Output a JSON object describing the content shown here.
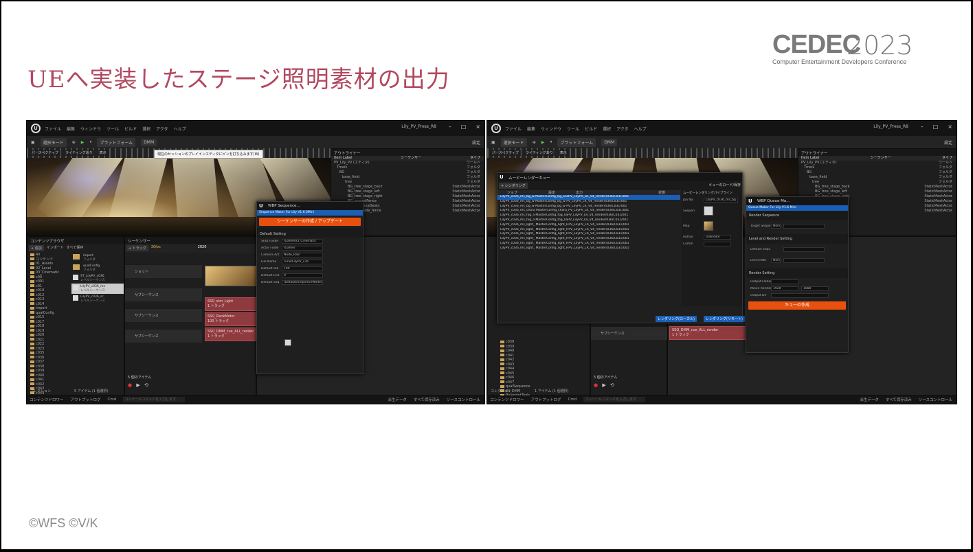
{
  "slide": {
    "title": "UEへ実装したステージ照明素材の出力",
    "logo_word": "CEDEC",
    "logo_year": "2023",
    "logo_sub": "Computer Entertainment Developers Conference",
    "copyright": "©WFS ©V/K",
    "title_color": "#b2485f"
  },
  "left": {
    "menu": [
      "ファイル",
      "編集",
      "ウィンドウ",
      "ツール",
      "ビルド",
      "選択",
      "アクタ",
      "ヘルプ"
    ],
    "window_title": "Lily_PV_Press_R8",
    "tab": "名称未設定",
    "toolbar": [
      "選択モード",
      "プラットフォーム",
      "DMM"
    ],
    "toolbar_right": "設定",
    "viewport_tools": [
      "パースペクティブ",
      "ライティングあり",
      "表示"
    ],
    "tooltip": "現在のセッションのプレイインエディタにピンを打ち込みます(W)",
    "outliner_title": "アウトライナー",
    "outliner_cols": [
      "Item Label",
      "シーケンサー",
      "タイプ"
    ],
    "outliner_rows": [
      [
        "PV_Lily_PV (エディタ)",
        "ワールド"
      ],
      [
        "Tmeik",
        "フォルダ"
      ],
      [
        "BG",
        "フォルダ"
      ],
      [
        "base_field",
        "フォルダ"
      ],
      [
        "tree",
        "フォルダ"
      ],
      [
        "BG_tree_stage_back",
        "StaticMeshActor"
      ],
      [
        "BG_tree_stage_left",
        "StaticMeshActor"
      ],
      [
        "BG_tree_stage_right",
        "StaticMeshActor"
      ],
      [
        "BG_aroundFence",
        "StaticMeshActor"
      ],
      [
        "BG_audienceSeats",
        "StaticMeshActor"
      ],
      [
        "BG_backSide_fence",
        "StaticMeshActor"
      ]
    ],
    "content_browser": "コンテンツブラウザ",
    "add_btn": "+ 追加",
    "import_btn": "インポート",
    "save_all": "すべて保存",
    "tree": [
      "All",
      "コンテンツ",
      "01_Assets",
      "02_Level",
      "03_Cinematic",
      "c00",
      "c001",
      "c01",
      "c010",
      "c012",
      "c013",
      "c014",
      "import",
      "qualConfig",
      "c015",
      "c017",
      "c018",
      "c019",
      "c020",
      "c021",
      "c022",
      "c023",
      "c035",
      "c036",
      "c037",
      "c038",
      "c039",
      "c040",
      "c041",
      "c042",
      "c043",
      "c044"
    ],
    "assets": [
      {
        "name": "import",
        "type": "フォルダ"
      },
      {
        "name": "qualConfig",
        "type": "フォルダ"
      },
      {
        "name": "ST_LilyPV_c036",
        "type": "レベルシーケンス"
      },
      {
        "name": "LilyPV_c036_me",
        "type": "レベルシーケンス"
      },
      {
        "name": "LilyPV_c036_sc",
        "type": "レベルシーケンス"
      }
    ],
    "asset_count": "5 アイテム (1 個選択)",
    "collection": "コレクション",
    "sequencer_title": "シーケンサー",
    "track_btn": "+ トラック",
    "fps": "30fps",
    "frame": "2020",
    "tracks": [
      "ショット",
      "サブシーケンス",
      "サブシーケンス",
      "サブシーケンス"
    ],
    "clips": [
      "SSQ_stm_Light",
      "1 トラック",
      "SSQ_RankMotor",
      "100 トラック",
      "SSQ_DMM_cue_ALL_render",
      "1 トラック"
    ],
    "seq_items": "5 個のアイテム",
    "dialog_title": "WBP Sequence...",
    "dialog_blue": "Sequence Maker For Lily V1.6.0Mini",
    "dialog_btn": "シーケンサーの作成 / アップデート",
    "default_setting": "Default Setting",
    "props": [
      [
        "Shot Folder",
        "/Game/03_Cinematic"
      ],
      [
        "Actor Folde",
        "/Game/"
      ],
      [
        "Camera Act",
        "Node_Rain"
      ],
      [
        "File Name",
        "Tune/LilyPV_c36"
      ],
      [
        "Default Sta",
        "100"
      ],
      [
        "Default End",
        "0"
      ],
      [
        "Default Seq",
        "/Default/SequenceMode/la"
      ]
    ],
    "status": [
      "コンテンツドロワー",
      "アウトプットログ",
      "Cmd"
    ],
    "status_right": [
      "派生データ",
      "すべて保存済み",
      "ソースコントロール"
    ],
    "cmd_placeholder": "コンソールコマンドを入力します"
  },
  "right": {
    "menu": [
      "ファイル",
      "編集",
      "ウィンドウ",
      "ツール",
      "ビルド",
      "選択",
      "アクタ",
      "ヘルプ"
    ],
    "window_title": "Lily_PV_Press_R8",
    "tab": "名称未設定",
    "toolbar": [
      "選択モード",
      "プラットフォーム",
      "DMM"
    ],
    "toolbar_right": "設定",
    "viewport_tools": [
      "パースペクティブ",
      "ライティングあり",
      "表示"
    ],
    "outliner_title": "アウトライナー",
    "outliner_cols": [
      "Item Label",
      "シーケンサー",
      "タイプ"
    ],
    "outliner_rows": [
      [
        "PV_Lily_PV (エディタ)",
        "ワールド"
      ],
      [
        "Tmeik",
        "フォルダ"
      ],
      [
        "BG",
        "フォルダ"
      ],
      [
        "base_field",
        "フォルダ"
      ],
      [
        "tree",
        "フォルダ"
      ],
      [
        "BG_tree_stage_back",
        "StaticMeshActor"
      ],
      [
        "BG_tree_stage_left",
        "StaticMeshActor"
      ],
      [
        "BG_tree_stage_right",
        "StaticMeshActor"
      ],
      [
        "BG_aroundFence",
        "StaticMeshActor"
      ],
      [
        "BG_audienceSeats",
        "StaticMeshActor"
      ],
      [
        "BG_backSide_fence",
        "StaticMeshActor"
      ]
    ],
    "queue_title": "ムービーレンダーキュー",
    "render_btn": "+ レンダリング",
    "queue_cols": [
      "ジョブ",
      "設定",
      "出力",
      "状態"
    ],
    "queue_rows": [
      "LilyPV_c036_ms_bg_w MasterConfig_bg_ansPV_LilyPV_LR_V4_render/036/C031/001",
      "LilyPV_c036_ms_bg_w MasterConfig_bg_w PV_LilyPV_LR_V4_render/036/C031/001",
      "LilyPV_c036_ms_bg_w MasterConfig_bg_w PV_LilyPV_LR_V4_render/036/C031/001",
      "LilyPV_c036_ms_chara MasterConfig_chara_PV_LilyPV_LR_V4_render/036/C031/001",
      "LilyPV_c036_ms_fog_li MasterConfig_fog_liaPV_LilyPV_LR_V4_render/036/C031/001",
      "LilyPV_c036_ms_fog_li MasterConfig_fog_liaPV_LilyPV_LR_V4_render/036/C031/001",
      "LilyPV_c036_ms_light_ MasterConfig_light_HPV_LilyPV_LR_V4_render/036/C031/001",
      "LilyPV_c036_ms_light_ MasterConfig_light_HPV_LilyPV_LR_V4_render/036/C031/001",
      "LilyPV_c036_ms_light_ MasterConfig_light_HPV_LilyPV_LR_V4_render/036/C031/001",
      "LilyPV_c036_ms_light_ MasterConfig_light_HPV_LilyPV_LR_V4_render/036/C031/001",
      "LilyPV_c036_ms_light_ MasterConfig_light_HPV_LilyPV_LR_V4_render/036/C031/001",
      "LilyPV_c036_ms_light_ MasterConfig_light_HPV_LilyPV_LR_V4_render/036/C031/001"
    ],
    "queue_load": "キューのロード/保存",
    "render_local": "レンダリング(ローカル)",
    "render_remote": "レンダリング(リモート)",
    "pipeline": "ムービーレンダリングパイプライン",
    "job_label": "Job Na",
    "job_value": "LilyPV_c036_ms_bg",
    "seq_label": "Sequen",
    "map_label": "Map",
    "author_label": "Author",
    "author_value": "unknown",
    "comment_label": "Comm",
    "queue_dialog_title": "WBP Queue Ma...",
    "queue_dialog_blue": "Queue Maker For Lily V1.6 Mini",
    "render_seq": "Render Sequence",
    "target_seq": "Target Seque",
    "none": "None",
    "lsa_setting": "Level and Render Setting",
    "default_seq": "Default Sequ",
    "level_path": "Level Path",
    "render_setting": "Render Setting",
    "output_folder": "Output Folder",
    "movie_render": "Movie Render",
    "res_w": "1920",
    "res_h": "1080",
    "output_dir": "Output Dir",
    "queue_btn": "キューの作成",
    "tree": [
      "c038",
      "c039",
      "c040",
      "c041",
      "c042",
      "c043",
      "c044",
      "c045",
      "c046",
      "c047",
      "qualSequence",
      "04_DMM",
      "BlueprintTools",
      "Render Output",
      "Render Tool",
      "SequenceTool",
      "Characters"
    ],
    "track": "サブシーケンス",
    "clip": "SSQ_DMM_cue_ALL_render",
    "clip2": "1 トラック",
    "seq_items": "5 個のアイテム",
    "asset_count": "1 アイテム (1 個選択)",
    "collection": "コレクション",
    "status": [
      "コンテンツドロワー",
      "アウトプットログ",
      "Cmd"
    ],
    "status_right": [
      "派生データ",
      "すべて保存済み",
      "ソースコントロール"
    ],
    "cmd_placeholder": "コンソールコマンドを入力します"
  }
}
